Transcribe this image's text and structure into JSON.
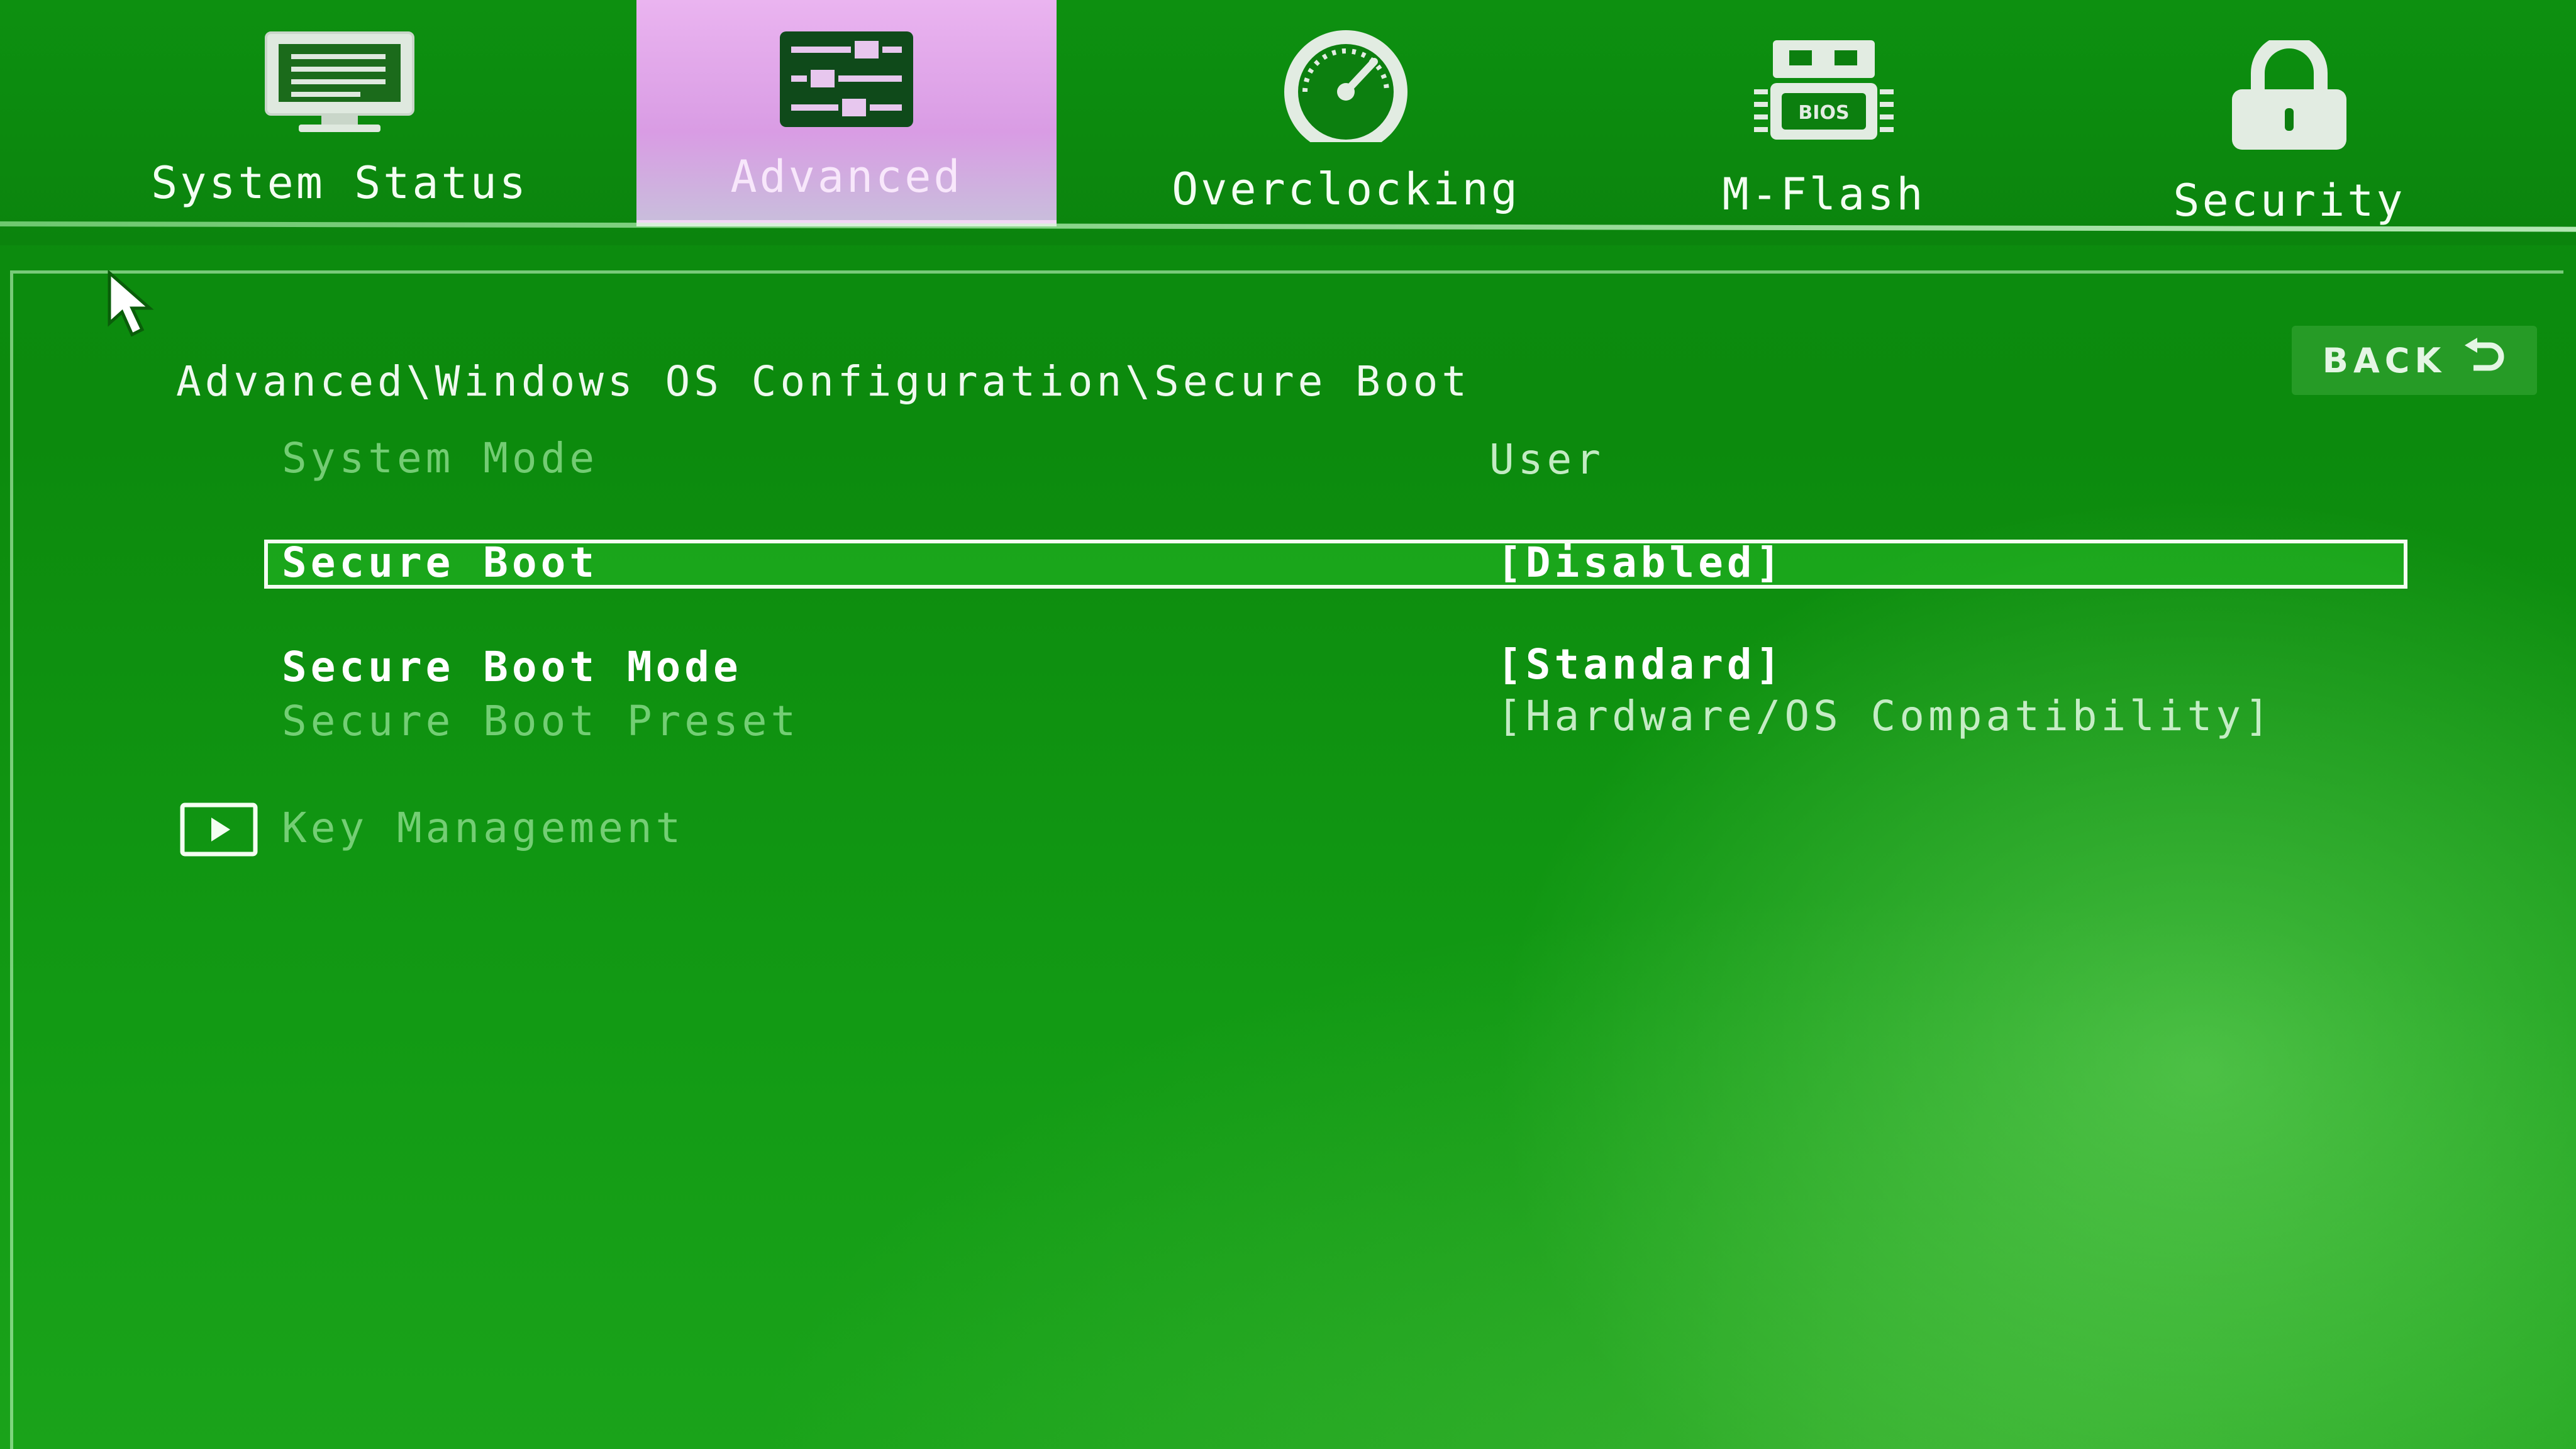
{
  "tabs": [
    {
      "label": "System Status",
      "icon": "monitor-icon",
      "active": false
    },
    {
      "label": "Advanced",
      "icon": "sliders-icon",
      "active": true
    },
    {
      "label": "Overclocking",
      "icon": "gauge-icon",
      "active": false
    },
    {
      "label": "M-Flash",
      "icon": "bios-chip-icon",
      "active": false
    },
    {
      "label": "Security",
      "icon": "lock-icon",
      "active": false
    }
  ],
  "bios_chip_text": "BIOS",
  "breadcrumb": "Advanced\\Windows OS Configuration\\Secure Boot",
  "back_button": {
    "label": "BACK",
    "icon": "return-arrow-icon"
  },
  "settings": {
    "system_mode": {
      "label": "System Mode",
      "value": "User"
    },
    "secure_boot": {
      "label": "Secure Boot",
      "value": "[Disabled]"
    },
    "secure_boot_mode": {
      "label": "Secure Boot Mode",
      "value": "[Standard]"
    },
    "secure_boot_preset": {
      "label": "Secure Boot Preset",
      "value": "[Hardware/OS Compatibility]"
    },
    "key_management": {
      "label": "Key Management",
      "icon": "submenu-arrow-icon"
    }
  },
  "colors": {
    "background": "#0c8a0d",
    "active_tab": "#e0a8ea",
    "text": "#eef9ee",
    "highlight_border": "#f4fff2"
  }
}
